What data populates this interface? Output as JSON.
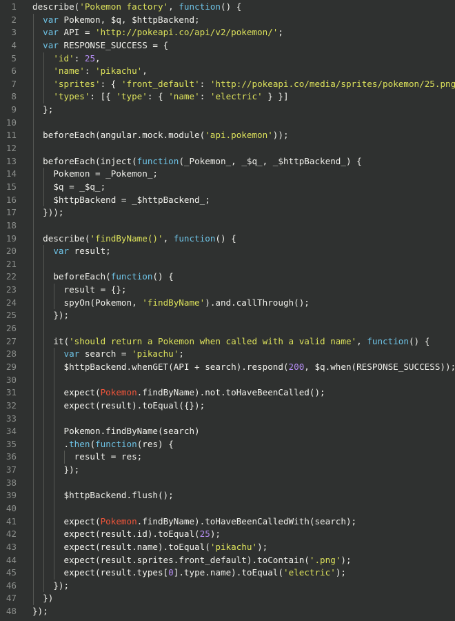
{
  "editor": {
    "colors": {
      "background": "#2f3130",
      "line_number": "#8c8f8c",
      "default": "#f1f1ec",
      "string": "#dce15b",
      "keyword": "#6ec3e6",
      "number": "#b48cf2",
      "identifier_highlight": "#f0553a",
      "indent_guide": "#555753"
    },
    "lines": [
      {
        "num": "1",
        "indent": 0,
        "tokens": [
          [
            "d",
            "describe("
          ],
          [
            "s",
            "'Pokemon factory'"
          ],
          [
            "d",
            ", "
          ],
          [
            "k",
            "function"
          ],
          [
            "d",
            "() {"
          ]
        ]
      },
      {
        "num": "2",
        "indent": 1,
        "tokens": [
          [
            "k",
            "var"
          ],
          [
            "d",
            " Pokemon, $q, $httpBackend;"
          ]
        ]
      },
      {
        "num": "3",
        "indent": 1,
        "tokens": [
          [
            "k",
            "var"
          ],
          [
            "d",
            " API = "
          ],
          [
            "s",
            "'http://pokeapi.co/api/v2/pokemon/'"
          ],
          [
            "d",
            ";"
          ]
        ]
      },
      {
        "num": "4",
        "indent": 1,
        "tokens": [
          [
            "k",
            "var"
          ],
          [
            "d",
            " RESPONSE_SUCCESS = {"
          ]
        ]
      },
      {
        "num": "5",
        "indent": 2,
        "tokens": [
          [
            "s",
            "'id'"
          ],
          [
            "d",
            ": "
          ],
          [
            "n",
            "25"
          ],
          [
            "d",
            ","
          ]
        ]
      },
      {
        "num": "6",
        "indent": 2,
        "tokens": [
          [
            "s",
            "'name'"
          ],
          [
            "d",
            ": "
          ],
          [
            "s",
            "'pikachu'"
          ],
          [
            "d",
            ","
          ]
        ]
      },
      {
        "num": "7",
        "indent": 2,
        "tokens": [
          [
            "s",
            "'sprites'"
          ],
          [
            "d",
            ": { "
          ],
          [
            "s",
            "'front_default'"
          ],
          [
            "d",
            ": "
          ],
          [
            "s",
            "'http://pokeapi.co/media/sprites/pokemon/25.png'"
          ],
          [
            "d",
            " },"
          ]
        ]
      },
      {
        "num": "8",
        "indent": 2,
        "tokens": [
          [
            "s",
            "'types'"
          ],
          [
            "d",
            ": [{ "
          ],
          [
            "s",
            "'type'"
          ],
          [
            "d",
            ": { "
          ],
          [
            "s",
            "'name'"
          ],
          [
            "d",
            ": "
          ],
          [
            "s",
            "'electric'"
          ],
          [
            "d",
            " } }]"
          ]
        ]
      },
      {
        "num": "9",
        "indent": 1,
        "tokens": [
          [
            "d",
            "};"
          ]
        ]
      },
      {
        "num": "10",
        "indent": 0,
        "tokens": []
      },
      {
        "num": "11",
        "indent": 1,
        "tokens": [
          [
            "d",
            "beforeEach(angular.mock.module("
          ],
          [
            "s",
            "'api.pokemon'"
          ],
          [
            "d",
            "));"
          ]
        ]
      },
      {
        "num": "12",
        "indent": 0,
        "tokens": []
      },
      {
        "num": "13",
        "indent": 1,
        "tokens": [
          [
            "d",
            "beforeEach(inject("
          ],
          [
            "k",
            "function"
          ],
          [
            "d",
            "(_Pokemon_, _$q_, _$httpBackend_) {"
          ]
        ]
      },
      {
        "num": "14",
        "indent": 2,
        "tokens": [
          [
            "d",
            "Pokemon = _Pokemon_;"
          ]
        ]
      },
      {
        "num": "15",
        "indent": 2,
        "tokens": [
          [
            "d",
            "$q = _$q_;"
          ]
        ]
      },
      {
        "num": "16",
        "indent": 2,
        "tokens": [
          [
            "d",
            "$httpBackend = _$httpBackend_;"
          ]
        ]
      },
      {
        "num": "17",
        "indent": 1,
        "tokens": [
          [
            "d",
            "}));"
          ]
        ]
      },
      {
        "num": "18",
        "indent": 0,
        "tokens": []
      },
      {
        "num": "19",
        "indent": 1,
        "tokens": [
          [
            "d",
            "describe("
          ],
          [
            "s",
            "'findByName()'"
          ],
          [
            "d",
            ", "
          ],
          [
            "k",
            "function"
          ],
          [
            "d",
            "() {"
          ]
        ]
      },
      {
        "num": "20",
        "indent": 2,
        "tokens": [
          [
            "k",
            "var"
          ],
          [
            "d",
            " result;"
          ]
        ]
      },
      {
        "num": "21",
        "indent": 0,
        "tokens": []
      },
      {
        "num": "22",
        "indent": 2,
        "tokens": [
          [
            "d",
            "beforeEach("
          ],
          [
            "k",
            "function"
          ],
          [
            "d",
            "() {"
          ]
        ]
      },
      {
        "num": "23",
        "indent": 3,
        "tokens": [
          [
            "d",
            "result = {};"
          ]
        ]
      },
      {
        "num": "24",
        "indent": 3,
        "tokens": [
          [
            "d",
            "spyOn(Pokemon, "
          ],
          [
            "s",
            "'findByName'"
          ],
          [
            "d",
            ").and.callThrough();"
          ]
        ]
      },
      {
        "num": "25",
        "indent": 2,
        "tokens": [
          [
            "d",
            "});"
          ]
        ]
      },
      {
        "num": "26",
        "indent": 0,
        "tokens": []
      },
      {
        "num": "27",
        "indent": 2,
        "tokens": [
          [
            "d",
            "it("
          ],
          [
            "s",
            "'should return a Pokemon when called with a valid name'"
          ],
          [
            "d",
            ", "
          ],
          [
            "k",
            "function"
          ],
          [
            "d",
            "() {"
          ]
        ]
      },
      {
        "num": "28",
        "indent": 3,
        "tokens": [
          [
            "k",
            "var"
          ],
          [
            "d",
            " search = "
          ],
          [
            "s",
            "'pikachu'"
          ],
          [
            "d",
            ";"
          ]
        ]
      },
      {
        "num": "29",
        "indent": 3,
        "tokens": [
          [
            "d",
            "$httpBackend.whenGET(API + search).respond("
          ],
          [
            "n",
            "200"
          ],
          [
            "d",
            ", $q.when(RESPONSE_SUCCESS));"
          ]
        ]
      },
      {
        "num": "30",
        "indent": 0,
        "tokens": []
      },
      {
        "num": "31",
        "indent": 3,
        "tokens": [
          [
            "d",
            "expect("
          ],
          [
            "r",
            "Pokemon"
          ],
          [
            "d",
            ".findByName).not.toHaveBeenCalled();"
          ]
        ]
      },
      {
        "num": "32",
        "indent": 3,
        "tokens": [
          [
            "d",
            "expect(result).toEqual({});"
          ]
        ]
      },
      {
        "num": "33",
        "indent": 0,
        "tokens": []
      },
      {
        "num": "34",
        "indent": 3,
        "tokens": [
          [
            "d",
            "Pokemon.findByName(search)"
          ]
        ]
      },
      {
        "num": "35",
        "indent": 3,
        "tokens": [
          [
            "d",
            "."
          ],
          [
            "k",
            "then"
          ],
          [
            "d",
            "("
          ],
          [
            "k",
            "function"
          ],
          [
            "d",
            "(res) {"
          ]
        ]
      },
      {
        "num": "36",
        "indent": 4,
        "tokens": [
          [
            "d",
            "result = res;"
          ]
        ]
      },
      {
        "num": "37",
        "indent": 3,
        "tokens": [
          [
            "d",
            "});"
          ]
        ]
      },
      {
        "num": "38",
        "indent": 0,
        "tokens": []
      },
      {
        "num": "39",
        "indent": 3,
        "tokens": [
          [
            "d",
            "$httpBackend.flush();"
          ]
        ]
      },
      {
        "num": "40",
        "indent": 0,
        "tokens": []
      },
      {
        "num": "41",
        "indent": 3,
        "tokens": [
          [
            "d",
            "expect("
          ],
          [
            "r",
            "Pokemon"
          ],
          [
            "d",
            ".findByName).toHaveBeenCalledWith(search);"
          ]
        ]
      },
      {
        "num": "42",
        "indent": 3,
        "tokens": [
          [
            "d",
            "expect(result.id).toEqual("
          ],
          [
            "n",
            "25"
          ],
          [
            "d",
            ");"
          ]
        ]
      },
      {
        "num": "43",
        "indent": 3,
        "tokens": [
          [
            "d",
            "expect(result.name).toEqual("
          ],
          [
            "s",
            "'pikachu'"
          ],
          [
            "d",
            ");"
          ]
        ]
      },
      {
        "num": "44",
        "indent": 3,
        "tokens": [
          [
            "d",
            "expect(result.sprites.front_default).toContain("
          ],
          [
            "s",
            "'.png'"
          ],
          [
            "d",
            ");"
          ]
        ]
      },
      {
        "num": "45",
        "indent": 3,
        "tokens": [
          [
            "d",
            "expect(result.types["
          ],
          [
            "n",
            "0"
          ],
          [
            "d",
            "].type.name).toEqual("
          ],
          [
            "s",
            "'electric'"
          ],
          [
            "d",
            ");"
          ]
        ]
      },
      {
        "num": "46",
        "indent": 2,
        "tokens": [
          [
            "d",
            "});"
          ]
        ]
      },
      {
        "num": "47",
        "indent": 1,
        "tokens": [
          [
            "d",
            "})"
          ]
        ]
      },
      {
        "num": "48",
        "indent": 0,
        "tokens": [
          [
            "d",
            "});"
          ]
        ]
      }
    ]
  }
}
